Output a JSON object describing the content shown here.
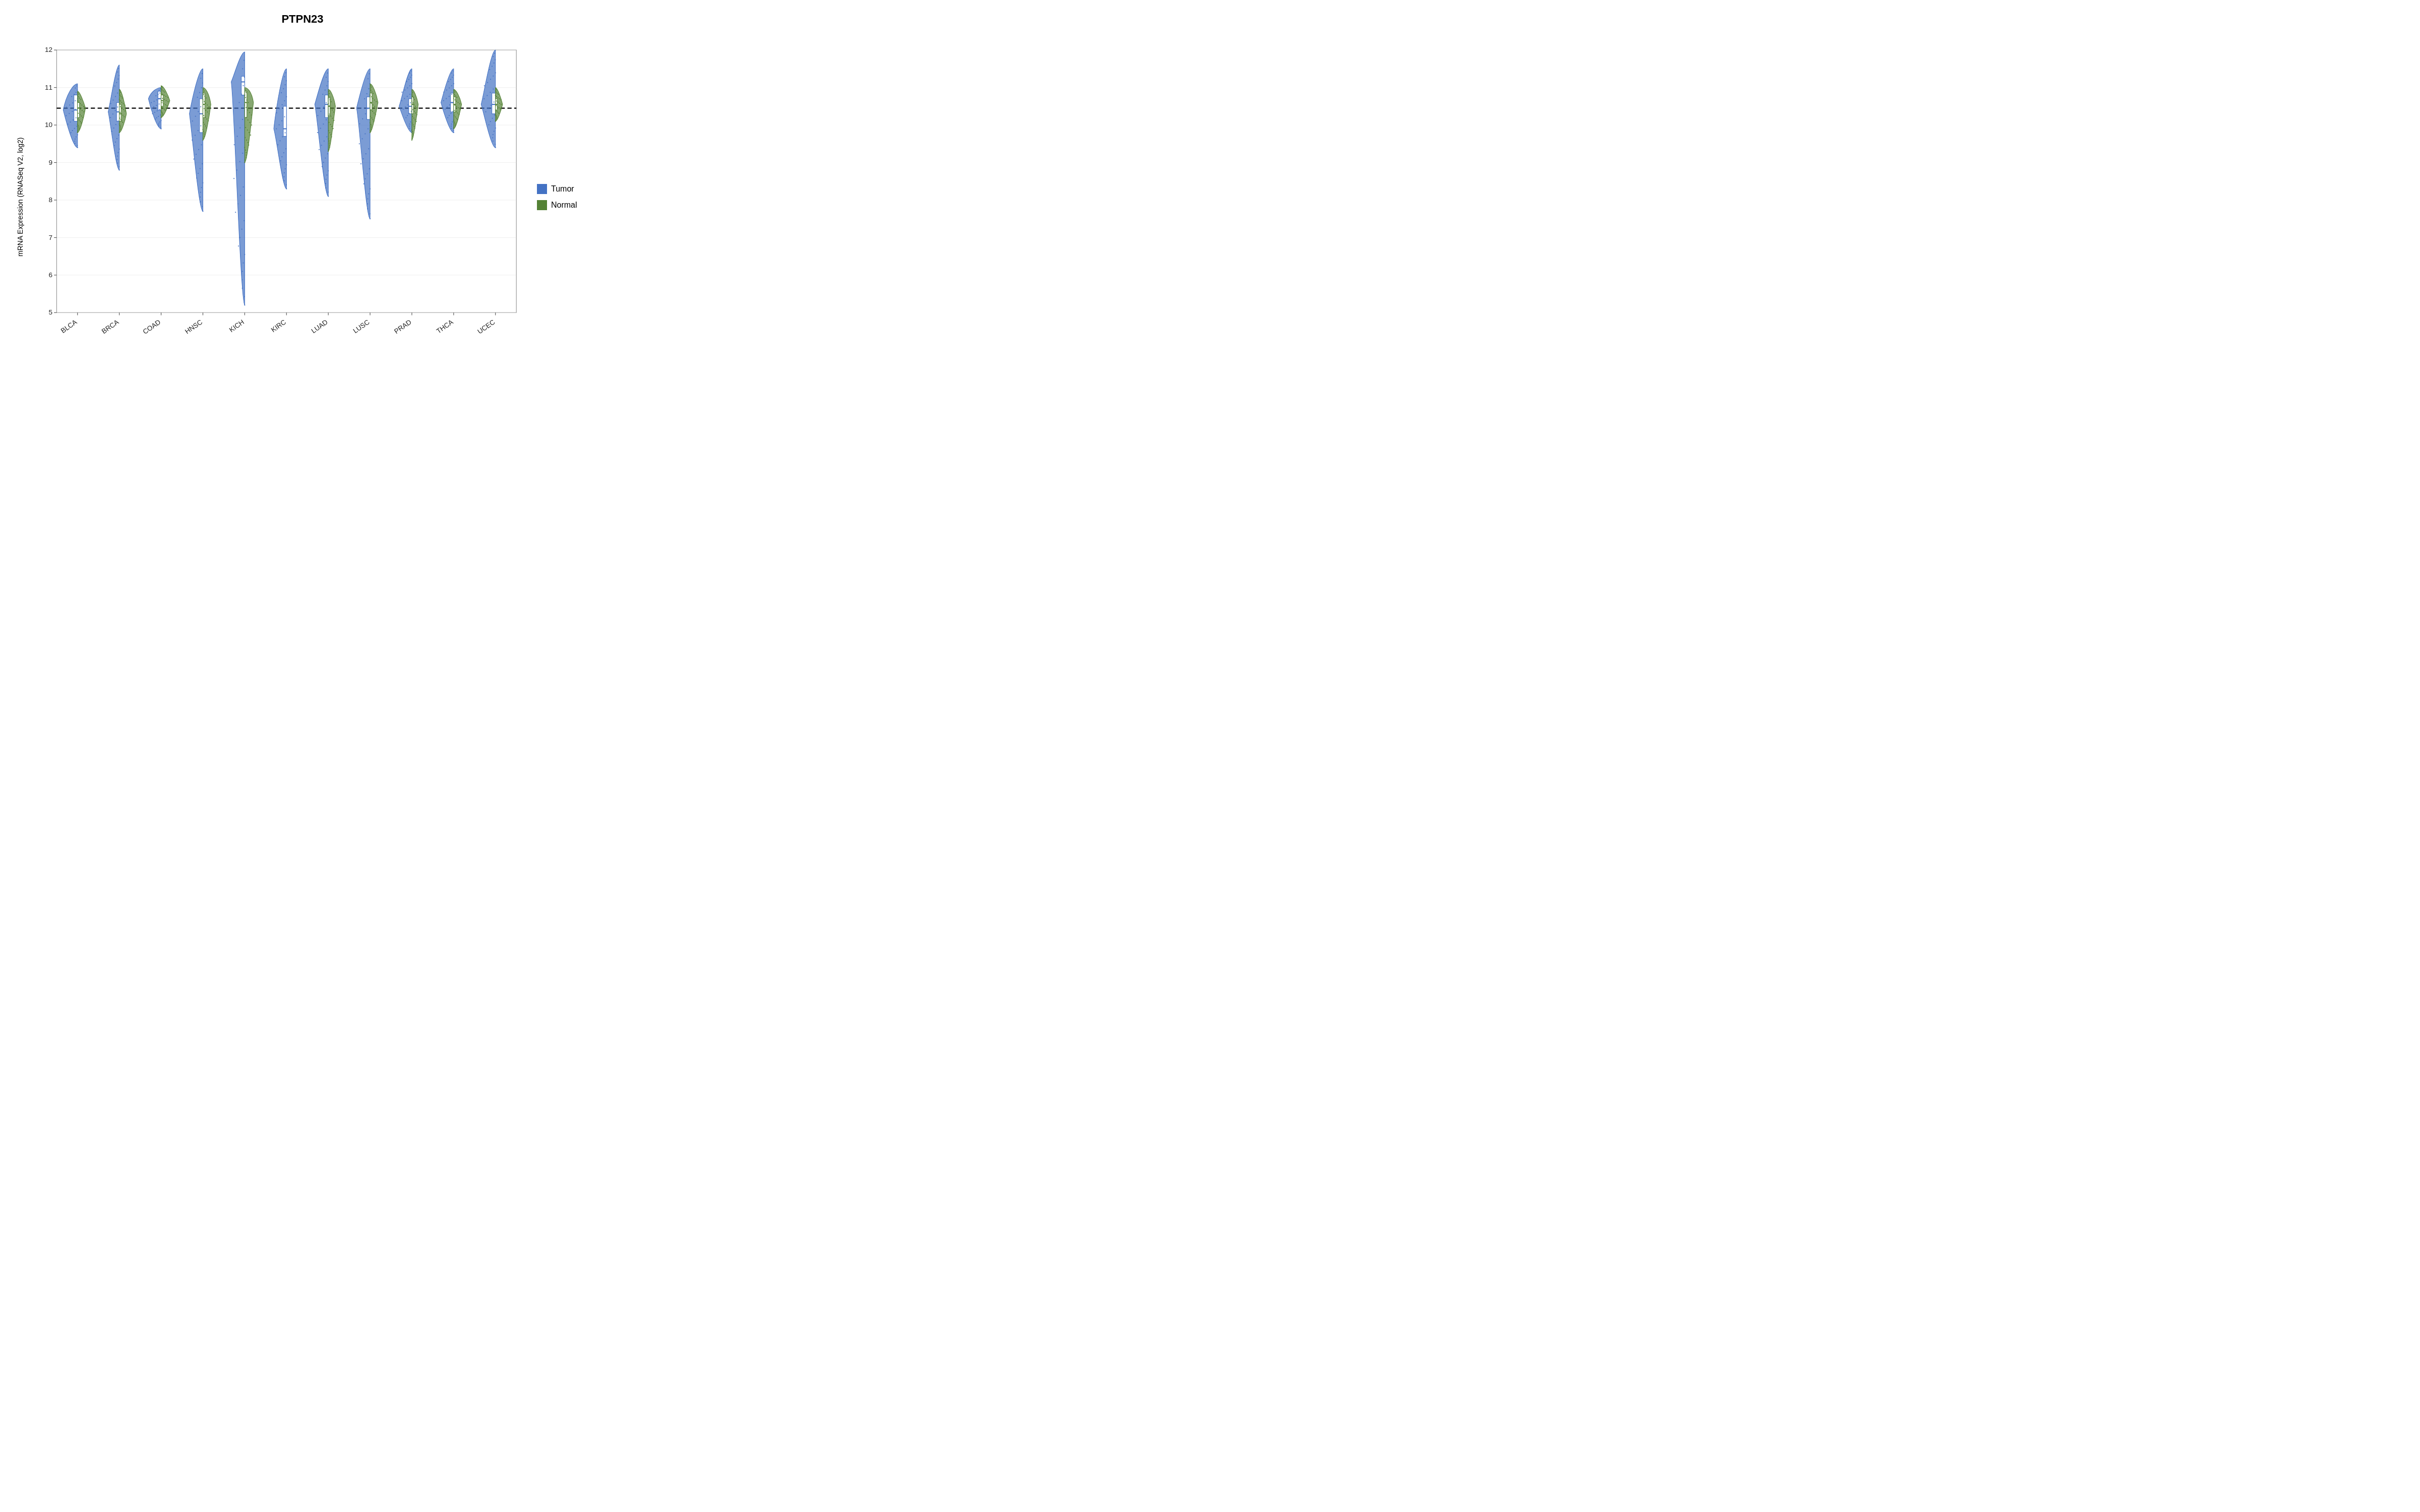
{
  "title": "PTPN23",
  "yAxisLabel": "mRNA Expression (RNASeq V2, log2)",
  "yAxis": {
    "min": 5,
    "max": 12,
    "ticks": [
      5,
      6,
      7,
      8,
      9,
      10,
      11,
      12
    ]
  },
  "xAxis": {
    "categories": [
      "BLCA",
      "BRCA",
      "COAD",
      "HNSC",
      "KICH",
      "KIRC",
      "LUAD",
      "LUSC",
      "PRAD",
      "THCA",
      "UCEC"
    ]
  },
  "referenceLine": 10.45,
  "legend": {
    "items": [
      {
        "label": "Tumor",
        "color": "#4472C4"
      },
      {
        "label": "Normal",
        "color": "#548235"
      }
    ]
  },
  "violins": [
    {
      "category": "BLCA",
      "tumor": {
        "min": 9.4,
        "q1": 10.1,
        "median": 10.4,
        "q3": 10.8,
        "max": 11.1,
        "width": 0.9
      },
      "normal": {
        "min": 9.8,
        "q1": 10.2,
        "median": 10.45,
        "q3": 10.6,
        "max": 10.9,
        "width": 0.5
      }
    },
    {
      "category": "BRCA",
      "tumor": {
        "min": 8.8,
        "q1": 10.1,
        "median": 10.35,
        "q3": 10.6,
        "max": 11.6,
        "width": 0.7
      },
      "normal": {
        "min": 9.8,
        "q1": 10.1,
        "median": 10.3,
        "q3": 10.55,
        "max": 10.95,
        "width": 0.45
      }
    },
    {
      "category": "COAD",
      "tumor": {
        "min": 9.9,
        "q1": 10.4,
        "median": 10.7,
        "q3": 10.9,
        "max": 11.0,
        "width": 0.8
      },
      "normal": {
        "min": 10.2,
        "q1": 10.5,
        "median": 10.65,
        "q3": 10.8,
        "max": 11.05,
        "width": 0.55
      }
    },
    {
      "category": "HNSC",
      "tumor": {
        "min": 7.7,
        "q1": 9.8,
        "median": 10.3,
        "q3": 10.7,
        "max": 11.5,
        "width": 0.85
      },
      "normal": {
        "min": 9.6,
        "q1": 10.2,
        "median": 10.55,
        "q3": 10.85,
        "max": 11.0,
        "width": 0.5
      }
    },
    {
      "category": "KICH",
      "tumor": {
        "min": 5.2,
        "q1": 10.8,
        "median": 11.15,
        "q3": 11.3,
        "max": 11.95,
        "width": 0.85
      },
      "normal": {
        "min": 9.0,
        "q1": 10.2,
        "median": 10.6,
        "q3": 10.9,
        "max": 11.0,
        "width": 0.55
      }
    },
    {
      "category": "KIRC",
      "tumor": {
        "min": 8.3,
        "q1": 9.7,
        "median": 9.9,
        "q3": 10.5,
        "max": 11.5,
        "width": 0.8
      },
      "normal": null
    },
    {
      "category": "LUAD",
      "tumor": {
        "min": 8.1,
        "q1": 10.2,
        "median": 10.55,
        "q3": 10.8,
        "max": 11.5,
        "width": 0.85
      },
      "normal": {
        "min": 9.3,
        "q1": 10.25,
        "median": 10.5,
        "q3": 10.75,
        "max": 10.95,
        "width": 0.45
      }
    },
    {
      "category": "LUSC",
      "tumor": {
        "min": 7.5,
        "q1": 10.15,
        "median": 10.45,
        "q3": 10.75,
        "max": 11.5,
        "width": 0.85
      },
      "normal": {
        "min": 9.8,
        "q1": 10.4,
        "median": 10.6,
        "q3": 10.85,
        "max": 11.1,
        "width": 0.5
      }
    },
    {
      "category": "PRAD",
      "tumor": {
        "min": 9.8,
        "q1": 10.3,
        "median": 10.5,
        "q3": 10.7,
        "max": 11.5,
        "width": 0.8
      },
      "normal": {
        "min": 9.6,
        "q1": 10.3,
        "median": 10.55,
        "q3": 10.75,
        "max": 10.95,
        "width": 0.4
      }
    },
    {
      "category": "THCA",
      "tumor": {
        "min": 9.8,
        "q1": 10.35,
        "median": 10.6,
        "q3": 10.85,
        "max": 11.5,
        "width": 0.8
      },
      "normal": {
        "min": 9.9,
        "q1": 10.35,
        "median": 10.55,
        "q3": 10.75,
        "max": 10.95,
        "width": 0.5
      }
    },
    {
      "category": "UCEC",
      "tumor": {
        "min": 9.4,
        "q1": 10.3,
        "median": 10.55,
        "q3": 10.85,
        "max": 12.0,
        "width": 0.9
      },
      "normal": {
        "min": 10.1,
        "q1": 10.4,
        "median": 10.55,
        "q3": 10.7,
        "max": 11.0,
        "width": 0.45
      }
    }
  ]
}
